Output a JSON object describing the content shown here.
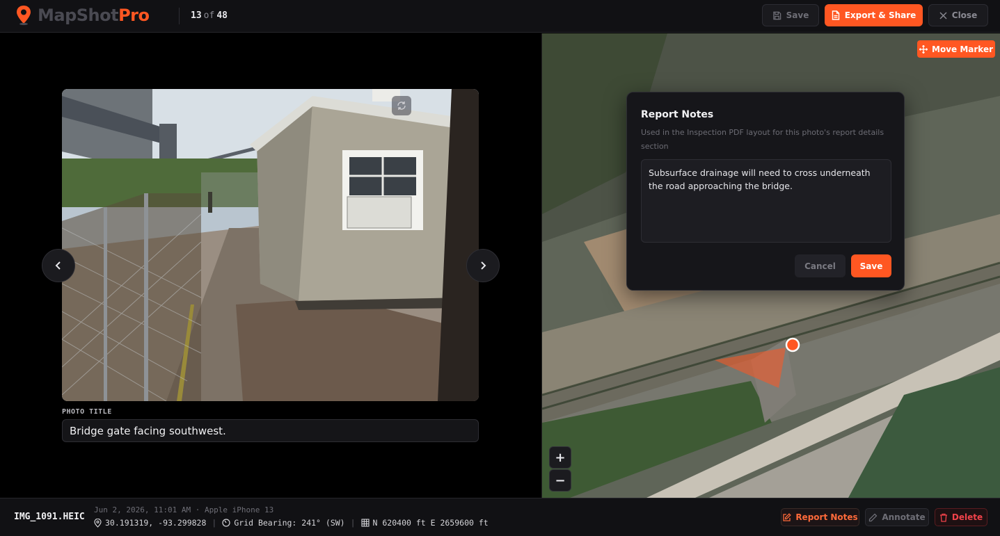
{
  "header": {
    "logo_part1": "MapShot",
    "logo_part2": "Pro",
    "counter_current": "13",
    "counter_of": "of",
    "counter_total": "48",
    "save_label": "Save",
    "export_label": "Export & Share",
    "close_label": "Close"
  },
  "photo": {
    "title_label": "PHOTO TITLE",
    "title_value": "Bridge gate facing southwest."
  },
  "map": {
    "move_marker_label": "Move Marker",
    "zoom_in": "+",
    "zoom_out": "−",
    "marker_color": "#ff5722"
  },
  "modal": {
    "title": "Report Notes",
    "description": "Used in the Inspection PDF layout for this photo's report details section",
    "notes_value": "Subsurface drainage will need to cross underneath the road approaching the bridge.",
    "cancel_label": "Cancel",
    "save_label": "Save"
  },
  "footer": {
    "filename": "IMG_1091.HEIC",
    "datetime_device": "Jun 2, 2026, 11:01 AM · Apple iPhone 13",
    "coordinates": "30.191319, -93.299828",
    "bearing": "Grid Bearing: 241° (SW)",
    "grid": "N 620400 ft E 2659600 ft",
    "report_notes_label": "Report Notes",
    "annotate_label": "Annotate",
    "delete_label": "Delete"
  },
  "colors": {
    "accent": "#ff5722",
    "danger": "#f0424a"
  }
}
